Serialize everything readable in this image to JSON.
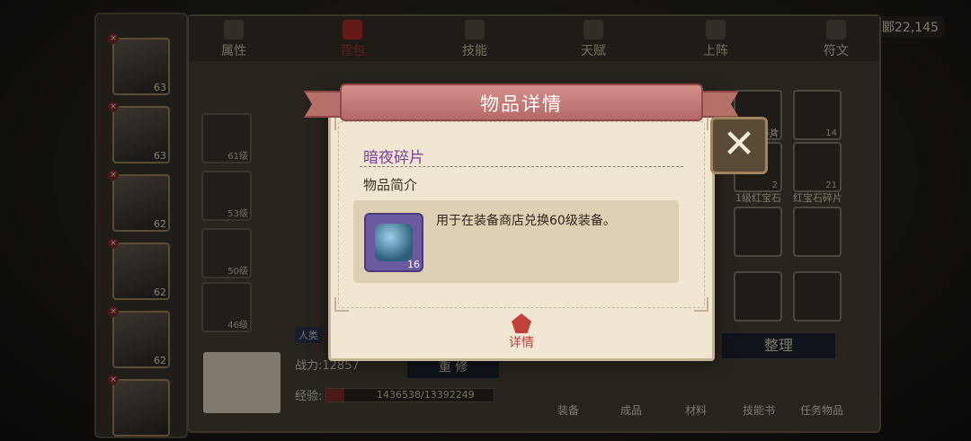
{
  "coords_text": "郾22,145",
  "tabs": [
    {
      "label": "属性",
      "icon": "flame-icon"
    },
    {
      "label": "背包",
      "icon": "bag-icon"
    },
    {
      "label": "技能",
      "icon": "book-icon"
    },
    {
      "label": "天赋",
      "icon": "eye-icon"
    },
    {
      "label": "上阵",
      "icon": "swords-icon"
    },
    {
      "label": "符文",
      "icon": "rune-icon"
    }
  ],
  "heroes": [
    {
      "level": "63"
    },
    {
      "level": "63"
    },
    {
      "level": "62"
    },
    {
      "level": "62"
    },
    {
      "level": "62"
    },
    {
      "level": ""
    }
  ],
  "equip_slots": [
    "61级",
    "53级",
    "50级",
    "46级"
  ],
  "stats": {
    "power": "战力:12857",
    "exp": "经验:",
    "exp_value": "1436538/13392249",
    "rebuild_button": "重 修",
    "tag": "人类"
  },
  "inventory_labels": [
    "蓝宝石碎片",
    "1级红宝石",
    "红宝石碎片"
  ],
  "inventory_counts": [
    "2",
    "14",
    "2",
    "21"
  ],
  "sort_button": "整理",
  "categories": [
    "装备",
    "成品",
    "材料",
    "技能书",
    "任务物品"
  ],
  "modal": {
    "title": "物品详情",
    "item_name": "暗夜碎片",
    "intro_label": "物品简介",
    "description": "用于在装备商店兑换60级装备。",
    "item_count": "16",
    "detail_button": "详情",
    "close_icon": "close-icon"
  },
  "colors": {
    "item_name": "#7d3f9c",
    "ribbon": "#c27a74",
    "active_tab": "#b8312f",
    "item_frame": "#6c5aa0"
  }
}
